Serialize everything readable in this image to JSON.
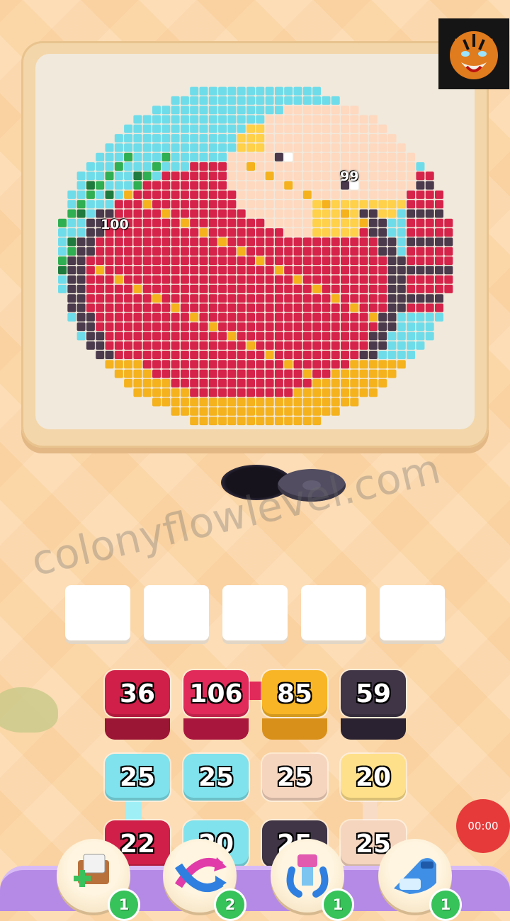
{
  "art": {
    "labels": {
      "left_count": "100",
      "right_count": "99"
    },
    "palette": {
      "sky": "#6fdcea",
      "leaf": "#2fae52",
      "leaf_dark": "#1e7a3d",
      "strawberry": "#d6234a",
      "seed": "#f5b21d",
      "dark": "#4a3a4c",
      "cream": "#ffd8c0",
      "yellow": "#ffd049",
      "white": "#ffffff"
    }
  },
  "slots": {
    "count": 5
  },
  "tiles": {
    "row1": [
      {
        "value": "36",
        "color": "#d01f48"
      },
      {
        "value": "106",
        "color": "#e12a5a"
      },
      {
        "value": "85",
        "color": "#f8b525"
      },
      {
        "value": "59",
        "color": "#3f3546"
      }
    ],
    "row2": [
      {
        "value": "25",
        "color": "#7fe2ec"
      },
      {
        "value": "25",
        "color": "#7fe2ec"
      },
      {
        "value": "25",
        "color": "#f6d5bf"
      },
      {
        "value": "20",
        "color": "#ffe08a"
      }
    ],
    "row3": [
      {
        "value": "22",
        "color": "#d01f48"
      },
      {
        "value": "20",
        "color": "#7fe2ec"
      },
      {
        "value": "25",
        "color": "#3f3546"
      },
      {
        "value": "25",
        "color": "#f6d5bf"
      }
    ]
  },
  "watermark": "colonyflowlevel.com",
  "timer": "00:00",
  "boosters": [
    {
      "name": "add-slot",
      "count": "1"
    },
    {
      "name": "shuffle",
      "count": "2"
    },
    {
      "name": "magnet",
      "count": "1"
    },
    {
      "name": "vacuum",
      "count": "1"
    }
  ]
}
